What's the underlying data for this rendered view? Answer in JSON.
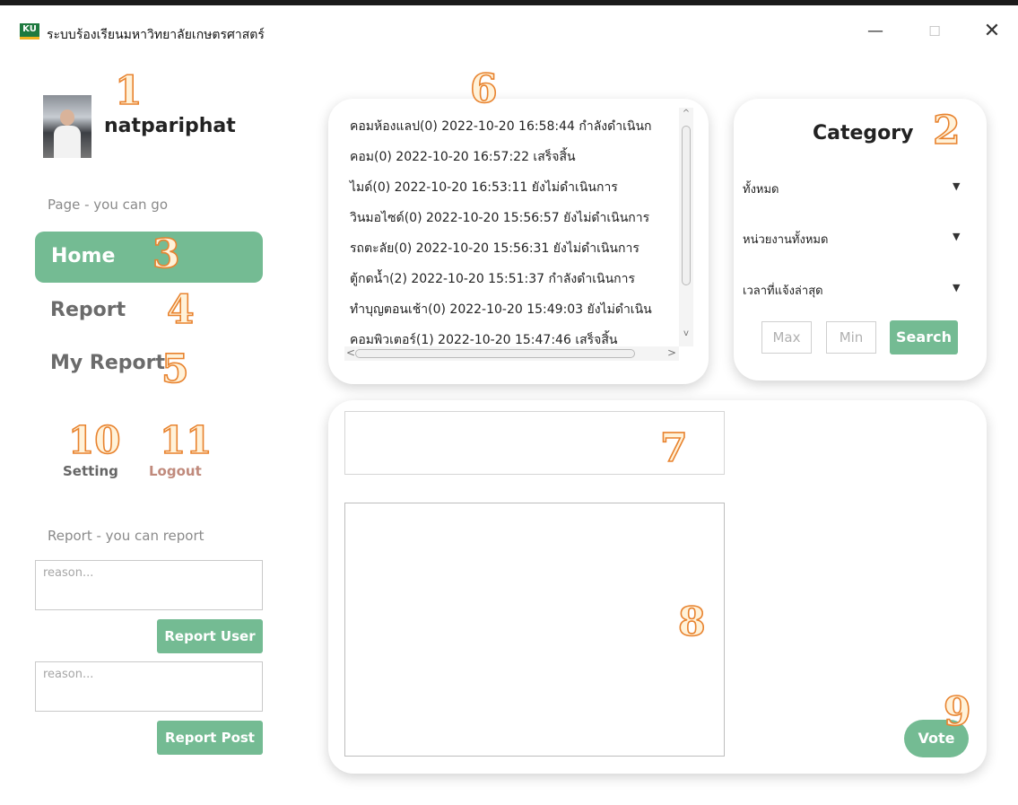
{
  "window": {
    "logo_text": "KU",
    "title": "ระบบร้องเรียนมหาวิทยาลัยเกษตรศาสตร์",
    "min_glyph": "—",
    "max_glyph": "☐",
    "close_glyph": "✕"
  },
  "sidebar": {
    "username": "natpariphat",
    "page_section_label": "Page - you can go",
    "nav": {
      "home": "Home",
      "report": "Report",
      "my_report": "My Report"
    },
    "setting": "Setting",
    "logout": "Logout",
    "report_section_label": "Report - you can report",
    "reason_placeholder_user": "reason...",
    "report_user_label": "Report User",
    "reason_placeholder_post": "reason...",
    "report_post_label": "Report Post"
  },
  "report_list": {
    "rows": [
      {
        "text": "คอมห้องแลป(0)   2022-10-20 16:58:44  กำลังดำเนินก"
      },
      {
        "text": "คอม(0)   2022-10-20 16:57:22  เสร็จสิ้น"
      },
      {
        "text": "ไมด์(0)   2022-10-20 16:53:11  ยังไม่ดำเนินการ"
      },
      {
        "text": "วินมอไซด์(0)   2022-10-20 15:56:57  ยังไม่ดำเนินการ"
      },
      {
        "text": "รถตะลัย(0)   2022-10-20 15:56:31  ยังไม่ดำเนินการ"
      },
      {
        "text": "ตู้กดน้ำ(2)   2022-10-20 15:51:37  กำลังดำเนินการ"
      },
      {
        "text": "ทำบุญตอนเช้า(0)   2022-10-20 15:49:03  ยังไม่ดำเนิน"
      },
      {
        "text": "คอมพิวเตอร์(1)   2022-10-20 15:47:46  เสร็จสิ้น"
      }
    ],
    "arrow_up": "^",
    "arrow_down": "v",
    "arrow_left": "<",
    "arrow_right": ">"
  },
  "category": {
    "title": "Category",
    "dropdowns": [
      {
        "label": "ทั้งหมด"
      },
      {
        "label": "หน่วยงานทั้งหมด"
      },
      {
        "label": "เวลาที่แจ้งล่าสุด"
      }
    ],
    "caret": "▼",
    "max_placeholder": "Max",
    "min_placeholder": "Min",
    "search_label": "Search"
  },
  "detail": {
    "vote_label": "Vote"
  },
  "annotations": [
    "1",
    "2",
    "3",
    "4",
    "5",
    "6",
    "7",
    "8",
    "9",
    "10",
    "11"
  ],
  "colors": {
    "accent_green": "#74bb93",
    "annotation_orange": "#e8832f",
    "logout_text": "#c08a7c"
  }
}
